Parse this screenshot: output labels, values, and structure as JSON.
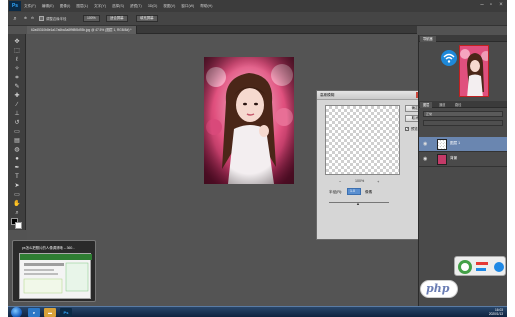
{
  "app": {
    "logo": "Ps",
    "menu": [
      "文件(F)",
      "编辑(E)",
      "图像(I)",
      "图层(L)",
      "文字(Y)",
      "选择(S)",
      "滤镜(T)",
      "3D(D)",
      "视图(V)",
      "窗口(W)",
      "帮助(H)"
    ]
  },
  "options_bar": {
    "tool_preset": "调整边缘半径",
    "btn1": "100%",
    "btn2": "适合屏幕",
    "btn3": "填充屏幕"
  },
  "document": {
    "tab_title": "62a65310b8e1a17a6ba3a8f9f8f8d93b.jpg @ 47.5% (图层 1, RGB/8#) *"
  },
  "dialog": {
    "title": "高斯模糊",
    "ok": "确定",
    "cancel": "取消",
    "preview_label": "预览(P)",
    "preview_checked": "✓",
    "zoom_percent": "100%",
    "zoom_out": "−",
    "zoom_in": "+",
    "radius_label": "半径(R):",
    "radius_value": "1.0",
    "radius_unit": "像素",
    "close": "x"
  },
  "panels": {
    "navigator_tab": "导航器",
    "layers_tab": "图层",
    "channels_tab": "通道",
    "paths_tab": "路径",
    "blend_mode": "正常",
    "layers": [
      {
        "name": "图层 1",
        "selected": true
      },
      {
        "name": "背景",
        "selected": false
      }
    ]
  },
  "taskbar": {
    "preview_title": "ps怎么把照片的人像调清晰 – 360...",
    "ps_icon": "Ps",
    "time": "16:03",
    "date": "2020/1/13"
  },
  "watermark": {
    "text": "php"
  },
  "colors": {
    "accent": "#31a8ff",
    "selected_layer": "#6a86b0",
    "workspace": "#535353"
  }
}
